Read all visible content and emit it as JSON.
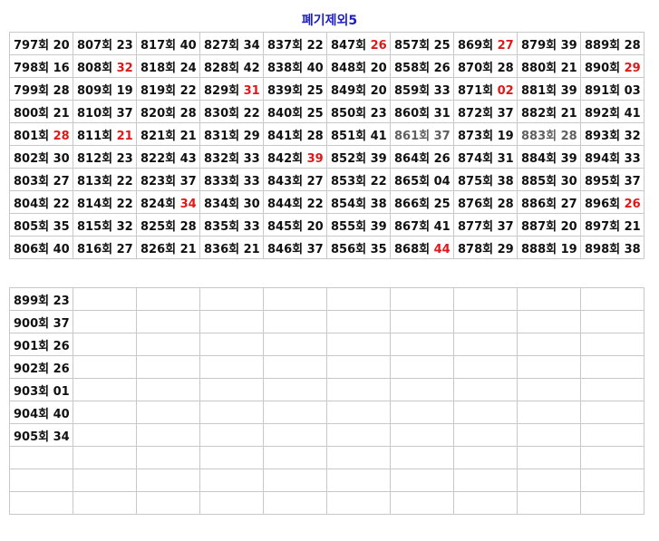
{
  "title": "폐기제외5",
  "suffix": "회",
  "grid1": [
    [
      [
        "797",
        "20"
      ],
      [
        "807",
        "23"
      ],
      [
        "817",
        "40"
      ],
      [
        "827",
        "34"
      ],
      [
        "837",
        "22"
      ],
      [
        "847",
        "26",
        "r"
      ],
      [
        "857",
        "25"
      ],
      [
        "869",
        "27",
        "r"
      ],
      [
        "879",
        "39"
      ],
      [
        "889",
        "28"
      ]
    ],
    [
      [
        "798",
        "16"
      ],
      [
        "808",
        "32",
        "r"
      ],
      [
        "818",
        "24"
      ],
      [
        "828",
        "42"
      ],
      [
        "838",
        "40"
      ],
      [
        "848",
        "20"
      ],
      [
        "858",
        "26"
      ],
      [
        "870",
        "28"
      ],
      [
        "880",
        "21"
      ],
      [
        "890",
        "29",
        "r"
      ]
    ],
    [
      [
        "799",
        "28"
      ],
      [
        "809",
        "19"
      ],
      [
        "819",
        "22"
      ],
      [
        "829",
        "31",
        "r"
      ],
      [
        "839",
        "25"
      ],
      [
        "849",
        "20"
      ],
      [
        "859",
        "33"
      ],
      [
        "871",
        "02",
        "r"
      ],
      [
        "881",
        "39"
      ],
      [
        "891",
        "03"
      ]
    ],
    [
      [
        "800",
        "21"
      ],
      [
        "810",
        "37"
      ],
      [
        "820",
        "28"
      ],
      [
        "830",
        "22"
      ],
      [
        "840",
        "25"
      ],
      [
        "850",
        "23"
      ],
      [
        "860",
        "31"
      ],
      [
        "872",
        "37"
      ],
      [
        "882",
        "21"
      ],
      [
        "892",
        "41"
      ]
    ],
    [
      [
        "801",
        "28",
        "r"
      ],
      [
        "811",
        "21",
        "r"
      ],
      [
        "821",
        "21"
      ],
      [
        "831",
        "29"
      ],
      [
        "841",
        "28"
      ],
      [
        "851",
        "41"
      ],
      [
        "861",
        "37",
        "g"
      ],
      [
        "873",
        "19"
      ],
      [
        "883",
        "28",
        "g"
      ],
      [
        "893",
        "32"
      ]
    ],
    [
      [
        "802",
        "30"
      ],
      [
        "812",
        "23"
      ],
      [
        "822",
        "43"
      ],
      [
        "832",
        "33"
      ],
      [
        "842",
        "39",
        "r"
      ],
      [
        "852",
        "39"
      ],
      [
        "864",
        "26"
      ],
      [
        "874",
        "31"
      ],
      [
        "884",
        "39"
      ],
      [
        "894",
        "33"
      ]
    ],
    [
      [
        "803",
        "27"
      ],
      [
        "813",
        "22"
      ],
      [
        "823",
        "37"
      ],
      [
        "833",
        "33"
      ],
      [
        "843",
        "27"
      ],
      [
        "853",
        "22"
      ],
      [
        "865",
        "04"
      ],
      [
        "875",
        "38"
      ],
      [
        "885",
        "30"
      ],
      [
        "895",
        "37"
      ]
    ],
    [
      [
        "804",
        "22"
      ],
      [
        "814",
        "22"
      ],
      [
        "824",
        "34",
        "r"
      ],
      [
        "834",
        "30"
      ],
      [
        "844",
        "22"
      ],
      [
        "854",
        "38"
      ],
      [
        "866",
        "25"
      ],
      [
        "876",
        "28"
      ],
      [
        "886",
        "27"
      ],
      [
        "896",
        "26",
        "r"
      ]
    ],
    [
      [
        "805",
        "35"
      ],
      [
        "815",
        "32"
      ],
      [
        "825",
        "28"
      ],
      [
        "835",
        "33"
      ],
      [
        "845",
        "20"
      ],
      [
        "855",
        "39"
      ],
      [
        "867",
        "41"
      ],
      [
        "877",
        "37"
      ],
      [
        "887",
        "20"
      ],
      [
        "897",
        "21"
      ]
    ],
    [
      [
        "806",
        "40"
      ],
      [
        "816",
        "27"
      ],
      [
        "826",
        "21"
      ],
      [
        "836",
        "21"
      ],
      [
        "846",
        "37"
      ],
      [
        "856",
        "35"
      ],
      [
        "868",
        "44",
        "r"
      ],
      [
        "878",
        "29"
      ],
      [
        "888",
        "19"
      ],
      [
        "898",
        "38"
      ]
    ]
  ],
  "grid2": [
    [
      [
        "899",
        "23"
      ]
    ],
    [
      [
        "900",
        "37"
      ]
    ],
    [
      [
        "901",
        "26"
      ]
    ],
    [
      [
        "902",
        "26"
      ]
    ],
    [
      [
        "903",
        "01"
      ]
    ],
    [
      [
        "904",
        "40"
      ]
    ],
    [
      [
        "905",
        "34"
      ]
    ],
    [],
    [],
    []
  ]
}
